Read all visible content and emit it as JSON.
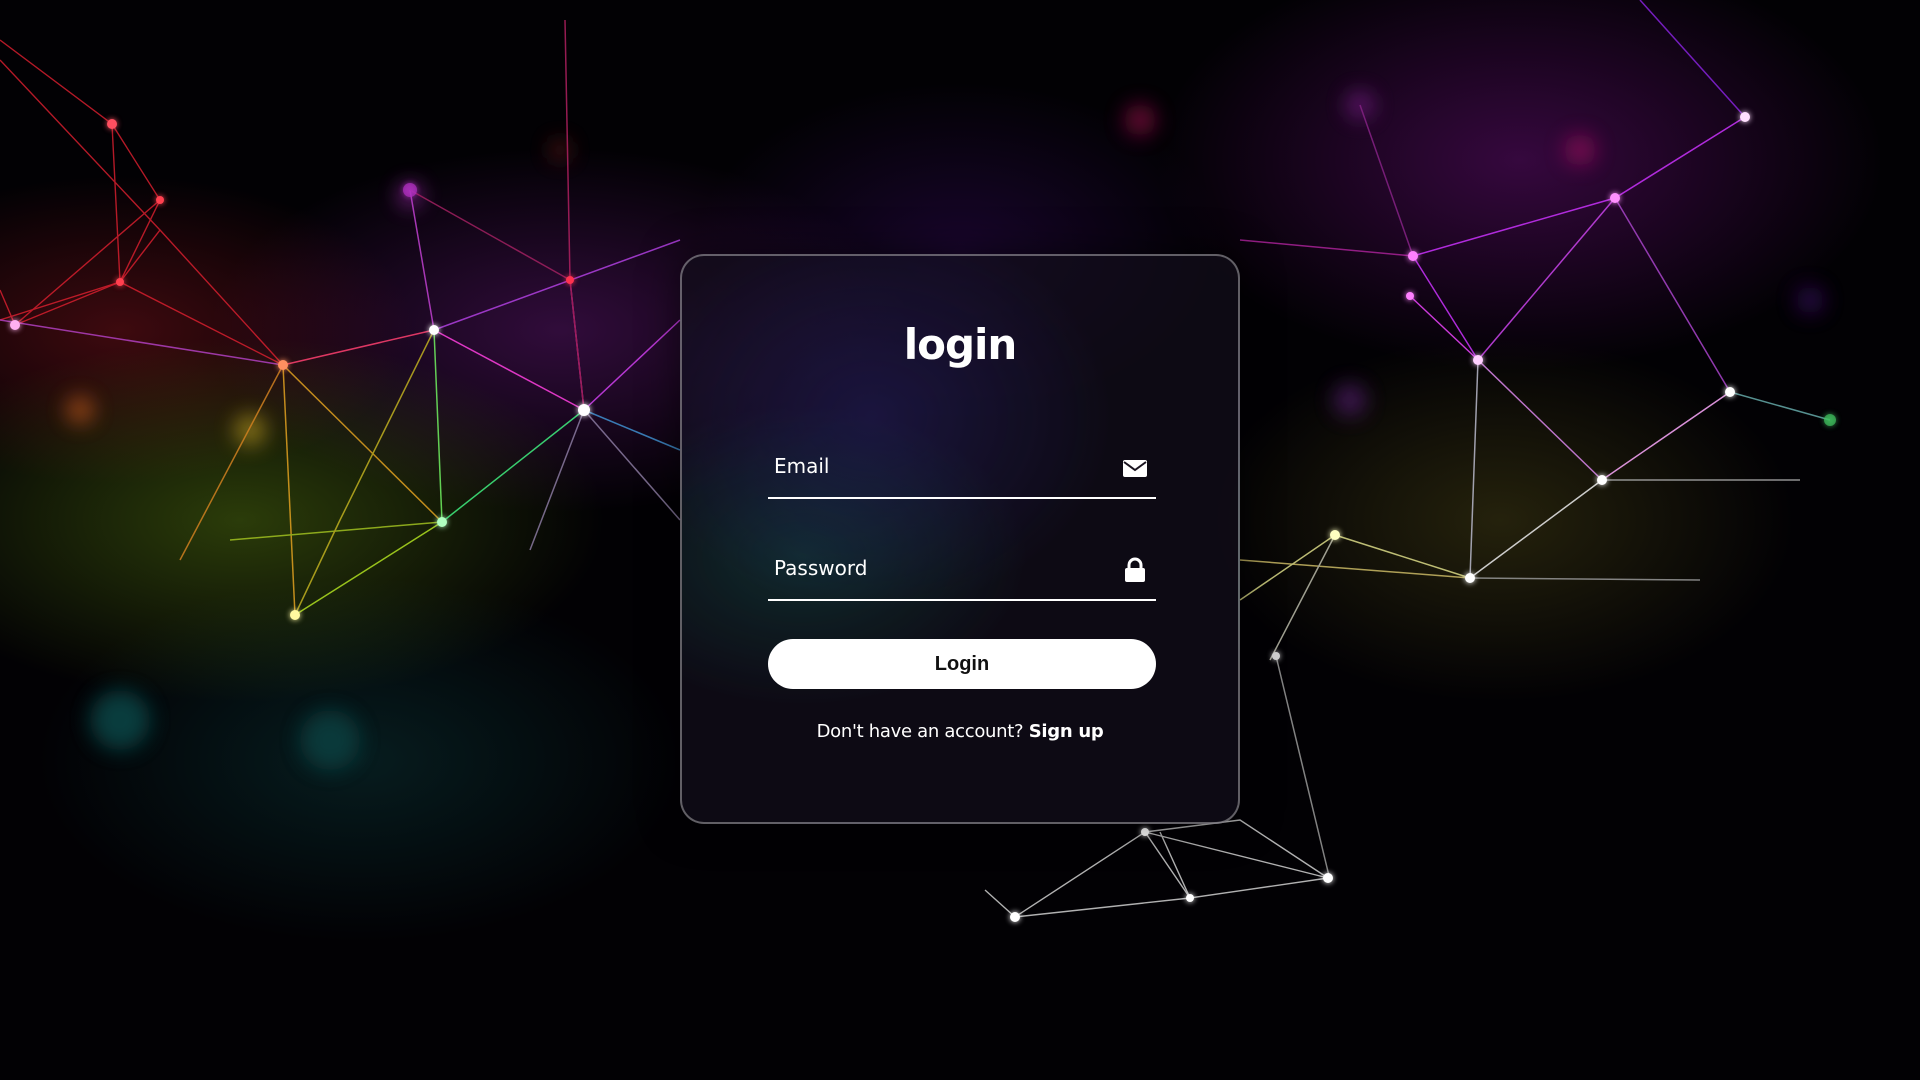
{
  "login_form": {
    "title": "login",
    "email": {
      "placeholder": "Email",
      "value": "",
      "icon": "envelope-icon"
    },
    "password": {
      "placeholder": "Password",
      "value": "",
      "icon": "lock-icon"
    },
    "submit_label": "Login",
    "signup_prompt": "Don't have an account?",
    "signup_link": "Sign up"
  },
  "theme": {
    "accent_text": "#ffffff",
    "button_bg": "#ffffff",
    "button_text": "#111111",
    "background": "#020104"
  }
}
